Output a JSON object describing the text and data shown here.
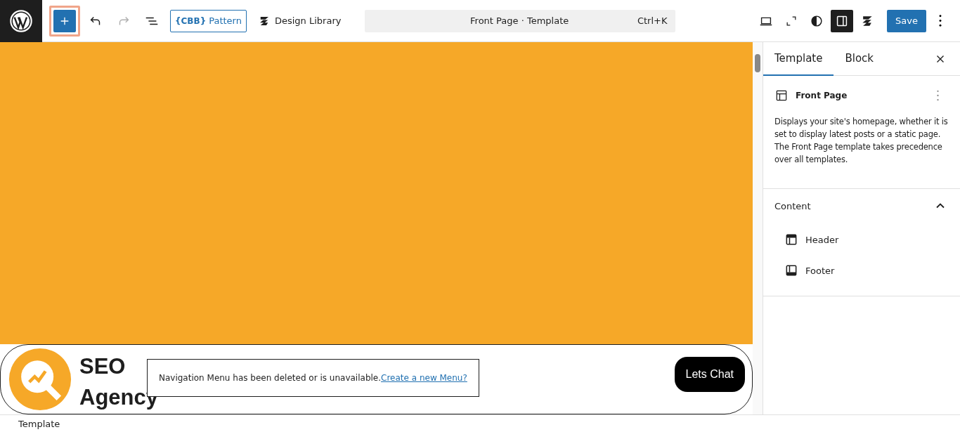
{
  "toolbar": {
    "inserter": {
      "highlighted": true
    },
    "undo": {
      "disabled": false
    },
    "redo": {
      "disabled": true
    },
    "pattern_button": {
      "brand": "{CBB}",
      "label": "Pattern"
    },
    "design_library": {
      "label": "Design Library"
    },
    "command_bar": {
      "title": "Front Page · Template",
      "shortcut": "Ctrl+K"
    },
    "settings_toggle": {
      "selected": true
    },
    "save": {
      "label": "Save"
    }
  },
  "canvas": {
    "logo_lines": [
      "SEO",
      "Agency"
    ],
    "nav_notice": {
      "text": "Navigation Menu has been deleted or is unavailable.",
      "link": "Create a new Menu?"
    },
    "cta": {
      "label": "Lets Chat"
    }
  },
  "sidebar": {
    "tabs": [
      {
        "label": "Template",
        "selected": true
      },
      {
        "label": "Block",
        "selected": false
      }
    ],
    "template": {
      "title": "Front Page",
      "description": "Displays your site's homepage, whether it is set to display latest posts or a static page. The Front Page template takes precedence over all templates."
    },
    "content": {
      "title": "Content",
      "expanded": true,
      "items": [
        {
          "label": "Header",
          "kind": "header"
        },
        {
          "label": "Footer",
          "kind": "footer"
        }
      ]
    }
  },
  "status_bar": {
    "breadcrumb": "Template"
  }
}
